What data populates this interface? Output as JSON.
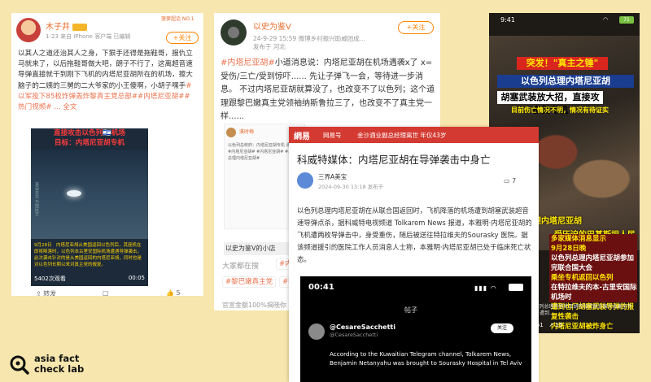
{
  "card1": {
    "username": "木子井",
    "meta": "1-23 来自 iPhone 客户端 已编辑",
    "tag": "菠萝超话 NO.1",
    "follow": "+关注",
    "body_pre": "以其人之道还治其人之身，下狠手还得是拖鞋哥，报仇立马就来了，以后拖鞋哥做大吧，朗子不行了，这离超音速导弹直接就干到刚下飞机的内塔尼亚胡所在的机场，擦大脑子的二姨的三舅的二大爷家的小王傻啊，小胡子嘿手",
    "body_tags": "#以军投下85枚炸弹轰炸黎真主党总部##内塔尼亚胡##热门视频#",
    "body_more": "... 全文",
    "video": {
      "title1": "直接攻击以色列🇮🇱机场",
      "title2": "目标：内塔尼亚胡专机",
      "side_text": "来自台北 与阿民方",
      "caption": "9月28日　内塔尼亚胡从美国返回以色列后，其座机在即将降落时，以色列本古里安国际机场遭遇导弹袭击，此次袭击针对的是从美国返回的内塔尼亚胡，同时也是对以色列长期以来对真主党的报复。",
      "views": "5402次观看",
      "duration": "00:05"
    },
    "actions": {
      "repost": "转发",
      "comment": "",
      "like": "5"
    }
  },
  "card2": {
    "username": "以史为鉴V",
    "meta": "24-9-29 15:59  微博乡村振兴助威团成...",
    "location": "发布于 河北",
    "follow": "+关注",
    "body_tag": "#内塔尼亚胡#",
    "body": "小道消息说：内塔尼亚胡在机场遇袭x了 x=受伤/三亡/受到惊吓...... 先让子弹飞一会，等待进一步消息。 不过内塔尼亚胡就算没了，也改变不了以色列；这个道理跟黎巴嫩真主党领袖纳斯鲁拉三了，也改变不了真主党一样......",
    "inner": {
      "username": "溪时梅",
      "body": "以色列总统府：内塔尼亚胡专机 遭到攻击 #内塔尼亚胡# #内塔尼亚胡# #以色列总理内塔尼亚胡#"
    },
    "repost_label": "以史为鉴V的小店",
    "tags_label": "大家都在搜",
    "tags": [
      "#内塔",
      "#黎巴嫩真主党",
      "#黎"
    ],
    "bottom": "官宣金额100%揭晓你"
  },
  "card3": {
    "logo": "網易",
    "section": "网易号",
    "trending": "金沙酒业副总经理离世 年仅43岁",
    "title": "科威特媒体：内塔尼亚胡在导弹袭击中身亡",
    "author": "三界A美宝",
    "date": "2024-09-30 13:18 发布于",
    "comments": "7",
    "body": "以色列总理内塔尼亚胡在从联合国返回时，飞机降落的机场遭到胡塞武装超音速导弹点杀，据科威特电视频道 Tolkarem News 报道，本雅明·内塔尼亚胡的飞机遭两枚导弹击中，身受重伤，随后被送往特拉维夫的Sourasky 医院。据该频道援引的医院工作人员消息人士称，本雅明·内塔尼亚胡已处于临床死亡状态。",
    "shot": {
      "time": "00:41",
      "page_title": "帖子",
      "handle_name": "@CesareSacchetti",
      "handle_sub": "@CesareSacchetti",
      "follow": "关注",
      "tweet": "According to the Kuwaitian Telegram channel, Tolkarem News, Benjamin Netanyahu was brought to Sourasky Hospital in Tel Aviv"
    }
  },
  "card4": {
    "time": "9:41",
    "battery": "71",
    "banner1": "突发！\"真主之锤\"",
    "banner2": "以色列总理内塔尼亚胡",
    "banner3": "胡塞武装放大招，直接攻击其专机",
    "banner4": "目前伤亡情况不明，情况有待证实",
    "subtitle1": "以色列总理内塔尼亚胡",
    "subtitle2": "受压迫的巴基斯坦人民",
    "news_lines": [
      "多家媒体消息显示",
      "9月28日晚",
      "以色列总理内塔尼亚胡参加完联合国大会",
      "乘坐专机返回以色列",
      "在特拉维夫的本-古里安国际机场时",
      "遭到也门胡塞武装导弹的报复性袭击",
      "内塔尼亚胡被炸身亡"
    ],
    "caption": "9月28日晚，以色列总理内塔尼亚胡参加完联合国大会乘坐专机返回以色列时，遭到...",
    "action_labels": [
      "8",
      "61",
      "15"
    ]
  },
  "logo": {
    "line1": "asia fact",
    "line2": "check lab"
  },
  "colors": {
    "background": "#f7e6ad",
    "weibo_orange": "#ff8200",
    "netease_red": "#d33a31"
  }
}
